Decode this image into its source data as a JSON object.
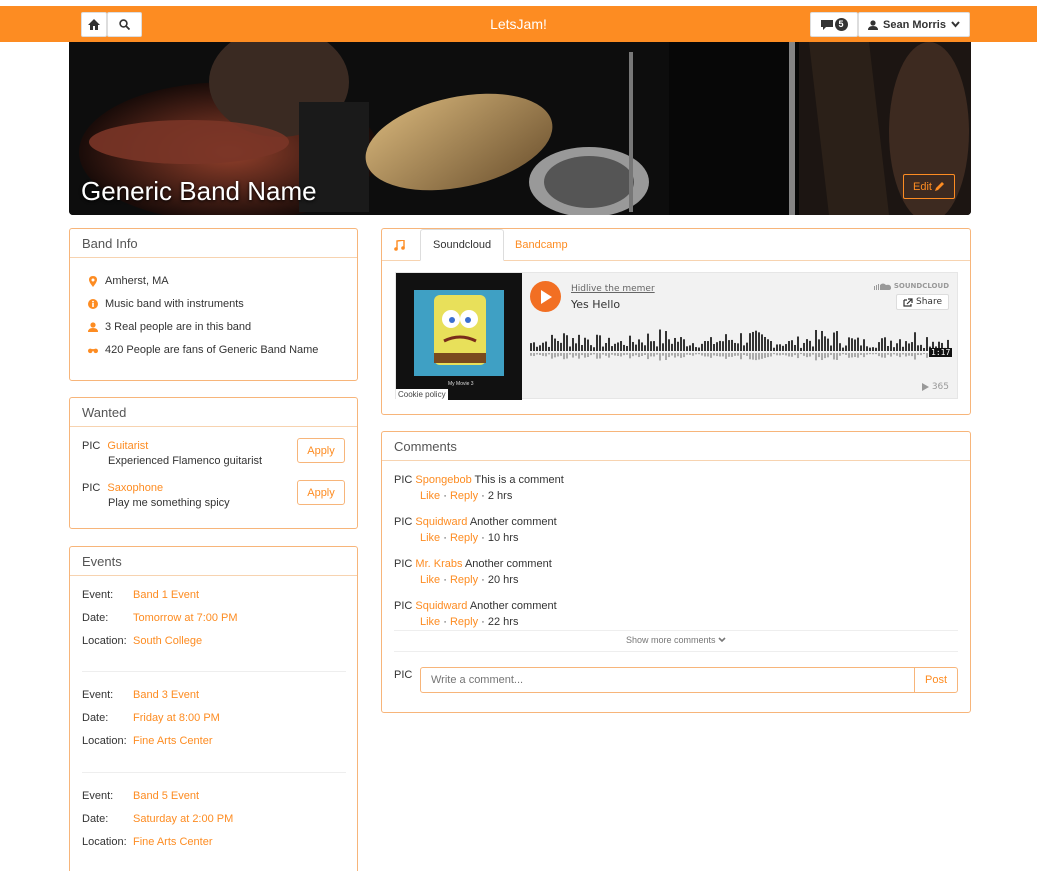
{
  "nav": {
    "title": "LetsJam!",
    "home_icon": "home-icon",
    "search_icon": "search-icon",
    "messages_count": "5",
    "user_name": "Sean Morris"
  },
  "hero": {
    "band_name": "Generic Band Name",
    "edit_label": "Edit"
  },
  "band_info": {
    "heading": "Band Info",
    "items": [
      {
        "icon": "location-pin-icon",
        "text": "Amherst, MA"
      },
      {
        "icon": "info-icon",
        "text": "Music band with instruments"
      },
      {
        "icon": "user-icon",
        "text": "3 Real people are in this band"
      },
      {
        "icon": "binoculars-icon",
        "text": "420 People are fans of Generic Band Name"
      }
    ]
  },
  "wanted": {
    "heading": "Wanted",
    "items": [
      {
        "pic": "PIC",
        "role": "Guitarist",
        "description": "Experienced Flamenco guitarist",
        "apply": "Apply"
      },
      {
        "pic": "PIC",
        "role": "Saxophone",
        "description": "Play me something spicy",
        "apply": "Apply"
      }
    ]
  },
  "events": {
    "heading": "Events",
    "labels": {
      "event": "Event:",
      "date": "Date:",
      "location": "Location:"
    },
    "items": [
      {
        "event": "Band 1 Event",
        "date": "Tomorrow at 7:00 PM",
        "location": "South College"
      },
      {
        "event": "Band 3 Event",
        "date": "Friday at 8:00 PM",
        "location": "Fine Arts Center"
      },
      {
        "event": "Band 5 Event",
        "date": "Saturday at 2:00 PM",
        "location": "Fine Arts Center"
      }
    ]
  },
  "music": {
    "tabs": [
      "Soundcloud",
      "Bandcamp"
    ],
    "active_tab": "Soundcloud",
    "player": {
      "artist": "Hidlive the memer",
      "track": "Yes Hello",
      "brand": "SOUNDCLOUD",
      "share": "Share",
      "duration": "1:17",
      "plays": "365",
      "cookie": "Cookie policy",
      "art_caption": "My Movie 3"
    }
  },
  "comments": {
    "heading": "Comments",
    "items": [
      {
        "pic": "PIC",
        "author": "Spongebob",
        "text": "This is a comment",
        "like": "Like",
        "reply": "Reply",
        "time": "2 hrs"
      },
      {
        "pic": "PIC",
        "author": "Squidward",
        "text": "Another comment",
        "like": "Like",
        "reply": "Reply",
        "time": "10 hrs"
      },
      {
        "pic": "PIC",
        "author": "Mr. Krabs",
        "text": "Another comment",
        "like": "Like",
        "reply": "Reply",
        "time": "20 hrs"
      },
      {
        "pic": "PIC",
        "author": "Squidward",
        "text": "Another comment",
        "like": "Like",
        "reply": "Reply",
        "time": "22 hrs"
      }
    ],
    "show_more": "Show more comments",
    "composer": {
      "pic": "PIC",
      "placeholder": "Write a comment...",
      "post": "Post"
    }
  },
  "colors": {
    "accent": "#fd8c22",
    "soundcloud": "#f26f23"
  }
}
